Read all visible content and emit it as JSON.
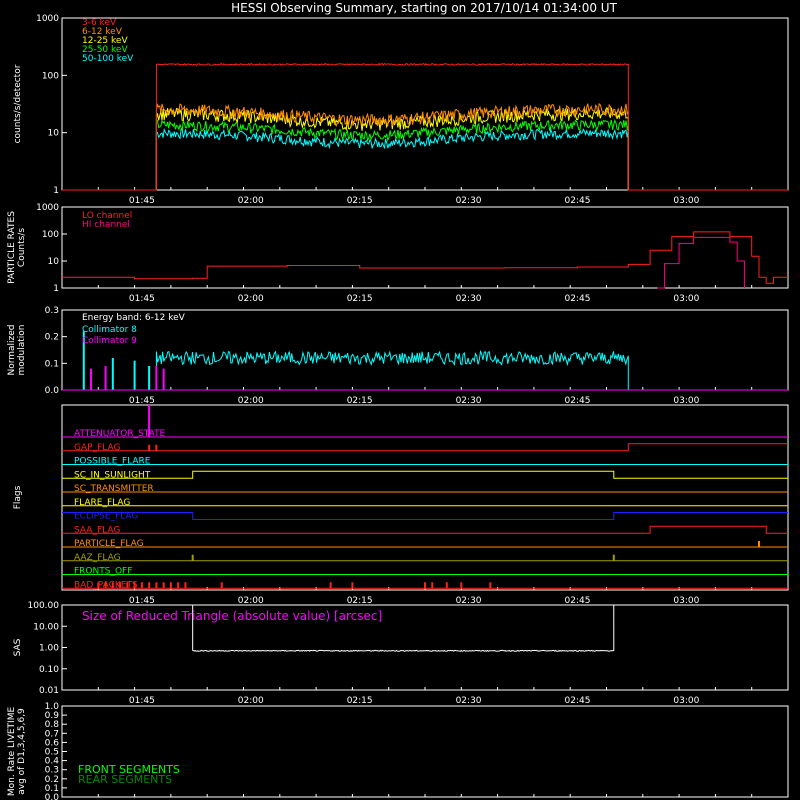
{
  "title": "HESSI Observing Summary, starting on 2017/10/14 01:34:00 UT",
  "time_axis": {
    "start": "01:34",
    "end": "03:14",
    "tick_labels": [
      "01:45",
      "02:00",
      "02:15",
      "02:30",
      "02:45",
      "03:00"
    ]
  },
  "chart_data": [
    {
      "type": "line",
      "id": "count-rates",
      "ylabel": "counts/s/detector",
      "yscale": "log",
      "ylim": [
        1,
        1000
      ],
      "tick_labels": [
        "1",
        "10",
        "100",
        "1000"
      ],
      "legend_position": "top-left",
      "series": [
        {
          "name": "3-6 keV",
          "color": "#ff2020",
          "base": 155,
          "jitter": 0.03,
          "baseline": 1,
          "on": "01:47",
          "off": "02:52"
        },
        {
          "name": "6-12 keV",
          "color": "#ff8c00",
          "base": 26,
          "jitter": 0.25,
          "baseline": 1,
          "on": "01:47",
          "off": "02:52"
        },
        {
          "name": "12-25 keV",
          "color": "#ffff00",
          "base": 22,
          "jitter": 0.25,
          "baseline": 1,
          "on": "01:47",
          "off": "02:52"
        },
        {
          "name": "25-50 keV",
          "color": "#00ff00",
          "base": 14,
          "jitter": 0.2,
          "baseline": 1,
          "on": "01:47",
          "off": "02:52"
        },
        {
          "name": "50-100 keV",
          "color": "#00ffff",
          "base": 10,
          "jitter": 0.2,
          "baseline": 1,
          "on": "01:47",
          "off": "02:52"
        }
      ]
    },
    {
      "type": "line",
      "id": "particle-rates",
      "ylabel": "PARTICLE RATES\nCounts/s",
      "yscale": "log",
      "ylim": [
        1,
        1000
      ],
      "tick_labels": [
        "1",
        "10",
        "100",
        "1000"
      ],
      "legend_position": "top-left",
      "series": [
        {
          "name": "LO channel",
          "color": "#ff2020",
          "points": [
            [
              "01:34",
              2.5
            ],
            [
              "01:43",
              2.5
            ],
            [
              "01:44",
              2.2
            ],
            [
              "01:52",
              2.3
            ],
            [
              "01:54",
              6.5
            ],
            [
              "02:05",
              6.8
            ],
            [
              "02:15",
              5.5
            ],
            [
              "02:25",
              5.5
            ],
            [
              "02:35",
              5.6
            ],
            [
              "02:45",
              6.0
            ],
            [
              "02:52",
              7.5
            ],
            [
              "02:55",
              25
            ],
            [
              "02:58",
              80
            ],
            [
              "03:01",
              120
            ],
            [
              "03:06",
              80
            ],
            [
              "03:09",
              15
            ],
            [
              "03:10",
              2.5
            ],
            [
              "03:11",
              1.5
            ],
            [
              "03:12",
              2.5
            ],
            [
              "03:14",
              2.5
            ]
          ]
        },
        {
          "name": "HI channel",
          "color": "#ff0080",
          "points": [
            [
              "02:56",
              1
            ],
            [
              "02:57",
              8
            ],
            [
              "02:59",
              45
            ],
            [
              "03:01",
              75
            ],
            [
              "03:04",
              75
            ],
            [
              "03:06",
              50
            ],
            [
              "03:07",
              10
            ],
            [
              "03:08",
              1
            ]
          ]
        }
      ]
    },
    {
      "type": "line",
      "id": "modulation",
      "ylabel": "Normalized\nmodulation",
      "ylim": [
        0.0,
        0.3
      ],
      "tick_labels": [
        "0.0",
        "0.1",
        "0.2",
        "0.3"
      ],
      "annotation": "Energy band: 6-12 keV",
      "legend_position": "top-left",
      "series": [
        {
          "name": "Collimator 8",
          "color": "#00ffff",
          "base": 0.12,
          "jitter": 0.025,
          "on": "01:47",
          "off": "02:52",
          "spikes": [
            [
              "01:37",
              0.22
            ],
            [
              "01:41",
              0.12
            ],
            [
              "01:44",
              0.11
            ],
            [
              "01:46",
              0.09
            ]
          ]
        },
        {
          "name": "Collimator 9",
          "color": "#ff00ff",
          "base": 0.0,
          "jitter": 0.0,
          "on": "01:34",
          "off": "03:14",
          "spikes": [
            [
              "01:38",
              0.08
            ],
            [
              "01:40",
              0.09
            ],
            [
              "01:47",
              0.09
            ],
            [
              "01:48",
              0.08
            ]
          ]
        }
      ]
    },
    {
      "type": "line",
      "id": "flags",
      "ylabel": "Flags",
      "series": [
        {
          "name": "ATTENUATOR_STATE",
          "color": "#ff00ff",
          "steps": [
            [
              "01:34",
              0
            ]
          ],
          "spike": "01:46"
        },
        {
          "name": "GAP_FLAG",
          "color": "#ff2020",
          "steps": [
            [
              "01:34",
              0
            ],
            [
              "02:52",
              1
            ]
          ],
          "marks": [
            "01:46",
            "01:47"
          ]
        },
        {
          "name": "POSSIBLE_FLARE",
          "color": "#00ffff",
          "steps": [
            [
              "01:34",
              0
            ]
          ]
        },
        {
          "name": "SC_IN_SUNLIGHT",
          "color": "#ffff00",
          "steps": [
            [
              "01:34",
              0
            ],
            [
              "01:52",
              1
            ],
            [
              "02:50",
              0
            ]
          ]
        },
        {
          "name": "SC_TRANSMITTER",
          "color": "#ff8c00",
          "steps": [
            [
              "01:34",
              0
            ]
          ]
        },
        {
          "name": "FLARE_FLAG",
          "color": "#ffff00",
          "steps": [
            [
              "01:34",
              0
            ]
          ]
        },
        {
          "name": "ECLIPSE_FLAG",
          "color": "#2020ff",
          "steps": [
            [
              "01:34",
              1
            ],
            [
              "01:52",
              0
            ],
            [
              "02:50",
              1
            ]
          ]
        },
        {
          "name": "SAA_FLAG",
          "color": "#ff2020",
          "steps": [
            [
              "01:34",
              0
            ],
            [
              "02:55",
              1
            ],
            [
              "03:11",
              0
            ]
          ]
        },
        {
          "name": "PARTICLE_FLAG",
          "color": "#ff8c00",
          "steps": [
            [
              "01:34",
              0
            ]
          ],
          "marks": [
            "03:10"
          ]
        },
        {
          "name": "AAZ_FLAG",
          "color": "#a0a000",
          "steps": [
            [
              "01:34",
              0
            ]
          ],
          "marks": [
            "01:52",
            "02:50"
          ]
        },
        {
          "name": "FRONTS_OFF",
          "color": "#00ff00",
          "steps": [
            [
              "01:34",
              0
            ]
          ]
        },
        {
          "name": "BAD_PACKETS",
          "color": "#ff2020",
          "steps": [
            [
              "01:34",
              0
            ]
          ],
          "marks": [
            "01:39",
            "01:40",
            "01:41",
            "01:42",
            "01:43",
            "01:44",
            "01:45",
            "01:46",
            "01:47",
            "01:48",
            "01:49",
            "01:50",
            "01:51",
            "01:56",
            "02:11",
            "02:14",
            "02:24",
            "02:25",
            "02:27",
            "02:29",
            "02:33"
          ]
        }
      ]
    },
    {
      "type": "line",
      "id": "sas",
      "ylabel": "SAS",
      "yscale": "log",
      "ylim": [
        0.01,
        100
      ],
      "tick_labels": [
        "0.01",
        "0.10",
        "1.00",
        "10.00",
        "100.00"
      ],
      "annotation": "Size of Reduced Triangle (absolute value) [arcsec]",
      "series": [
        {
          "name": "triangle",
          "color": "#ffffff",
          "base": 0.7,
          "jitter": 0.05,
          "on": "01:52",
          "off": "02:50"
        }
      ]
    },
    {
      "type": "line",
      "id": "livetime",
      "ylabel": "Mon. Rate LIVETIME\navg of D1,3,4,5,6,9",
      "ylim": [
        0.0,
        1.0
      ],
      "tick_labels": [
        "0.0",
        "0.1",
        "0.2",
        "0.3",
        "0.4",
        "0.5",
        "0.6",
        "0.7",
        "0.8",
        "0.9",
        "1.0"
      ],
      "series": [
        {
          "name": "FRONT SEGMENTS",
          "color": "#00ff00"
        },
        {
          "name": "REAR SEGMENTS",
          "color": "#008c00"
        }
      ]
    }
  ]
}
